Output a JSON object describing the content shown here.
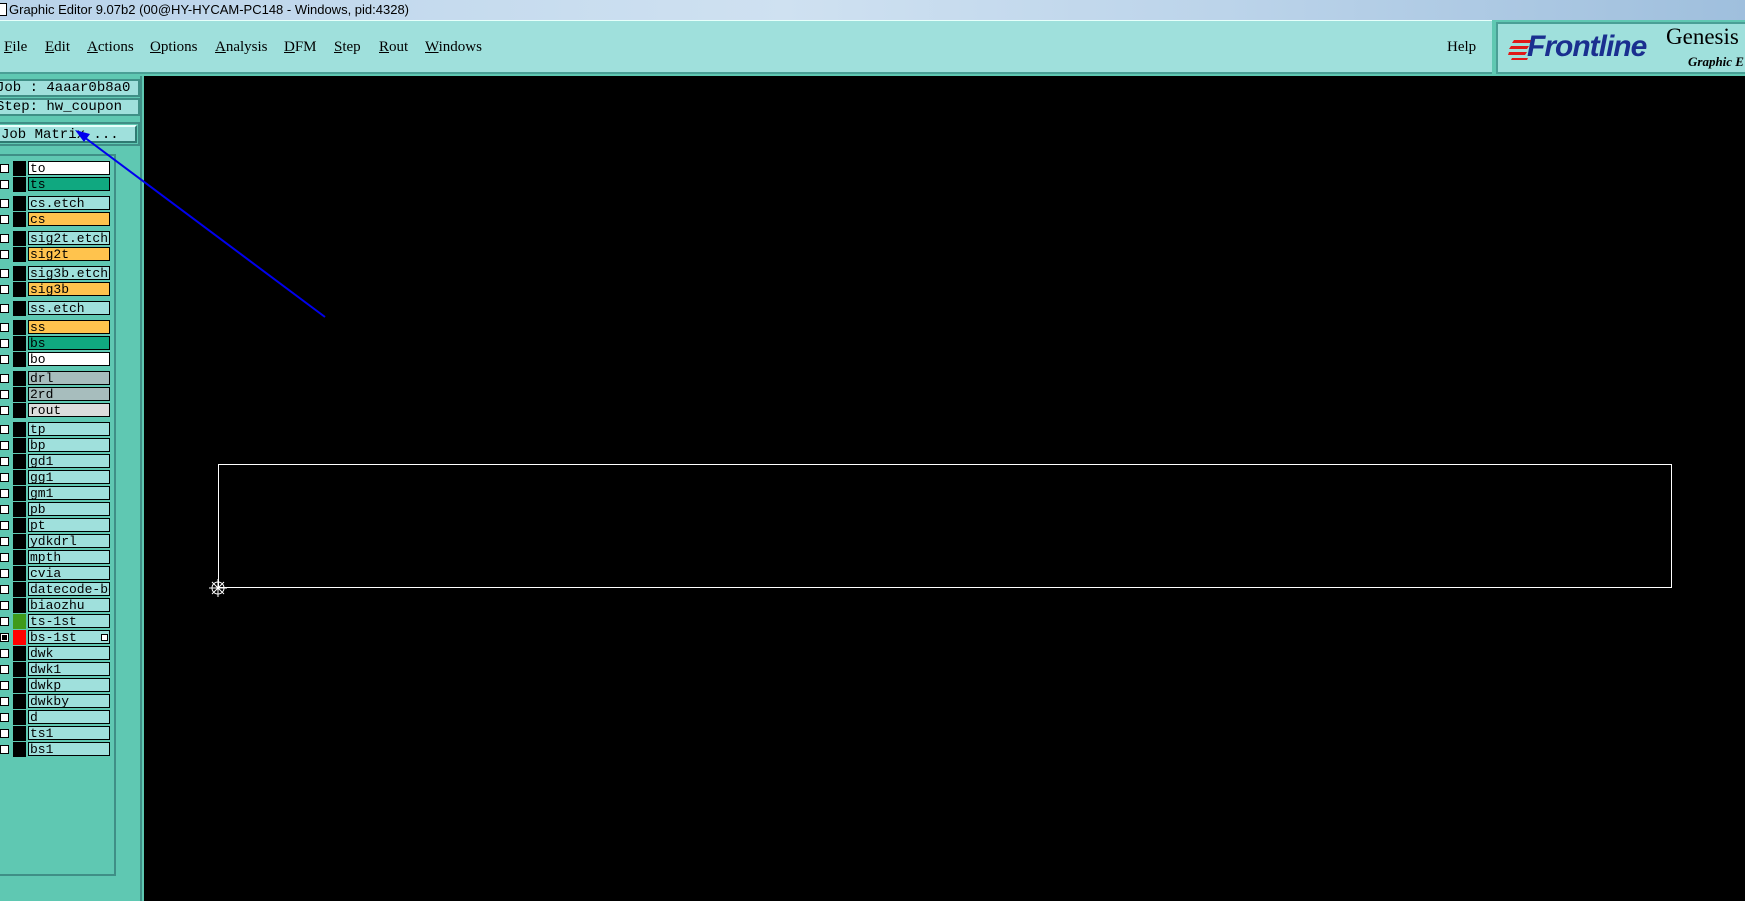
{
  "window": {
    "title": "Graphic Editor 9.07b2 (00@HY-HYCAM-PC148 - Windows, pid:4328)"
  },
  "menu": {
    "items": [
      {
        "mnemonic": "F",
        "rest": "ile"
      },
      {
        "mnemonic": "E",
        "rest": "dit"
      },
      {
        "mnemonic": "A",
        "rest": "ctions"
      },
      {
        "mnemonic": "O",
        "rest": "ptions"
      },
      {
        "mnemonic": "A",
        "rest": "nalysis"
      },
      {
        "mnemonic": "D",
        "rest": "FM"
      },
      {
        "mnemonic": "S",
        "rest": "tep"
      },
      {
        "mnemonic": "R",
        "rest": "out"
      },
      {
        "mnemonic": "W",
        "rest": "indows"
      }
    ],
    "help": "Help"
  },
  "brand": {
    "logo": "Frontline",
    "product": "Genesis",
    "subtitle": "Graphic E"
  },
  "job": {
    "label": "Job : 4aaar0b8a0",
    "step": "Step: hw_coupon",
    "matrix_button": "Job Matrix ..."
  },
  "colors": {
    "panel": "#5fc8b2",
    "field": "#9fe0dc",
    "canvas": "#000000",
    "outline": "#ffffff",
    "arrow": "#0000ee",
    "layer_white": "#ffffff",
    "layer_green": "#10a880",
    "layer_orange": "#ffc34d",
    "layer_light": "#9fe0dc",
    "layer_gray": "#a7bdbd",
    "layer_silver": "#dcdcdc",
    "swatch_green": "#3f9a1a",
    "swatch_red": "#ff0000"
  },
  "layers": [
    {
      "name": "to",
      "color": "#ffffff"
    },
    {
      "name": "ts",
      "color": "#10a880"
    },
    {
      "name": "cs.etch",
      "color": "#9fe0dc"
    },
    {
      "name": "cs",
      "color": "#ffc34d"
    },
    {
      "name": "sig2t.etch",
      "color": "#9fe0dc"
    },
    {
      "name": "sig2t",
      "color": "#ffc34d"
    },
    {
      "name": "sig3b.etch",
      "color": "#9fe0dc"
    },
    {
      "name": "sig3b",
      "color": "#ffc34d"
    },
    {
      "name": "ss.etch",
      "color": "#9fe0dc"
    },
    {
      "name": "ss",
      "color": "#ffc34d"
    },
    {
      "name": "bs",
      "color": "#10a880"
    },
    {
      "name": "bo",
      "color": "#ffffff"
    },
    {
      "name": "drl",
      "color": "#a7bdbd"
    },
    {
      "name": "2rd",
      "color": "#a7bdbd"
    },
    {
      "name": "rout",
      "color": "#dcdcdc"
    },
    {
      "name": "tp",
      "color": "#9fe0dc"
    },
    {
      "name": "bp",
      "color": "#9fe0dc"
    },
    {
      "name": "gd1",
      "color": "#9fe0dc"
    },
    {
      "name": "gg1",
      "color": "#9fe0dc"
    },
    {
      "name": "gm1",
      "color": "#9fe0dc"
    },
    {
      "name": "pb",
      "color": "#9fe0dc"
    },
    {
      "name": "pt",
      "color": "#9fe0dc"
    },
    {
      "name": "ydkdrl",
      "color": "#9fe0dc"
    },
    {
      "name": "mpth",
      "color": "#9fe0dc"
    },
    {
      "name": "cvia",
      "color": "#9fe0dc"
    },
    {
      "name": "datecode-bo",
      "color": "#9fe0dc"
    },
    {
      "name": "biaozhu",
      "color": "#9fe0dc"
    },
    {
      "name": "ts-1st",
      "color": "#9fe0dc",
      "swatch": "#3f9a1a"
    },
    {
      "name": "bs-1st",
      "color": "#9fe0dc",
      "swatch": "#ff0000",
      "checked": true,
      "marked": true
    },
    {
      "name": "dwk",
      "color": "#9fe0dc"
    },
    {
      "name": "dwk1",
      "color": "#9fe0dc"
    },
    {
      "name": "dwkp",
      "color": "#9fe0dc"
    },
    {
      "name": "dwkby",
      "color": "#9fe0dc"
    },
    {
      "name": "d",
      "color": "#9fe0dc"
    },
    {
      "name": "ts1",
      "color": "#9fe0dc"
    },
    {
      "name": "bs1",
      "color": "#9fe0dc"
    }
  ]
}
